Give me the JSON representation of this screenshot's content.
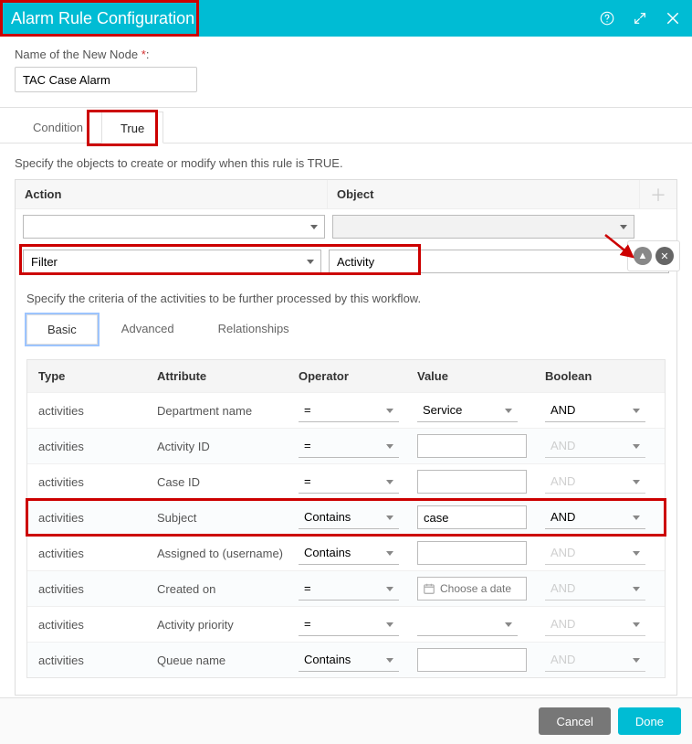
{
  "header": {
    "title": "Alarm Rule Configuration"
  },
  "form": {
    "node_name_label": "Name of the New Node",
    "node_name_value": "TAC Case Alarm"
  },
  "tabs": {
    "condition": "Condition",
    "true": "True"
  },
  "true_panel": {
    "spec_text": "Specify the objects to create or modify when this rule is TRUE.",
    "action_label": "Action",
    "object_label": "Object",
    "filter_value": "Filter",
    "activity_value": "Activity",
    "criteria_text": "Specify the criteria of the activities to be further processed by this workflow."
  },
  "subtabs": {
    "basic": "Basic",
    "advanced": "Advanced",
    "relationships": "Relationships"
  },
  "criteria_head": {
    "type": "Type",
    "attribute": "Attribute",
    "operator": "Operator",
    "value": "Value",
    "boolean": "Boolean"
  },
  "rows": [
    {
      "type": "activities",
      "attribute": "Department name",
      "operator": "=",
      "value": "Service",
      "value_kind": "select",
      "boolean": "AND",
      "bool_enabled": true
    },
    {
      "type": "activities",
      "attribute": "Activity ID",
      "operator": "=",
      "value": "",
      "value_kind": "input",
      "boolean": "AND",
      "bool_enabled": false
    },
    {
      "type": "activities",
      "attribute": "Case ID",
      "operator": "=",
      "value": "",
      "value_kind": "input",
      "boolean": "AND",
      "bool_enabled": false
    },
    {
      "type": "activities",
      "attribute": "Subject",
      "operator": "Contains",
      "value": "case",
      "value_kind": "input",
      "boolean": "AND",
      "bool_enabled": true,
      "highlight": true
    },
    {
      "type": "activities",
      "attribute": "Assigned to (username)",
      "operator": "Contains",
      "value": "",
      "value_kind": "input",
      "boolean": "AND",
      "bool_enabled": false
    },
    {
      "type": "activities",
      "attribute": "Created on",
      "operator": "=",
      "value": "",
      "value_kind": "date",
      "placeholder": "Choose a date",
      "boolean": "AND",
      "bool_enabled": false
    },
    {
      "type": "activities",
      "attribute": "Activity priority",
      "operator": "=",
      "value": "",
      "value_kind": "select",
      "boolean": "AND",
      "bool_enabled": false
    },
    {
      "type": "activities",
      "attribute": "Queue name",
      "operator": "Contains",
      "value": "",
      "value_kind": "input",
      "boolean": "AND",
      "bool_enabled": false
    }
  ],
  "footer": {
    "cancel": "Cancel",
    "done": "Done"
  }
}
